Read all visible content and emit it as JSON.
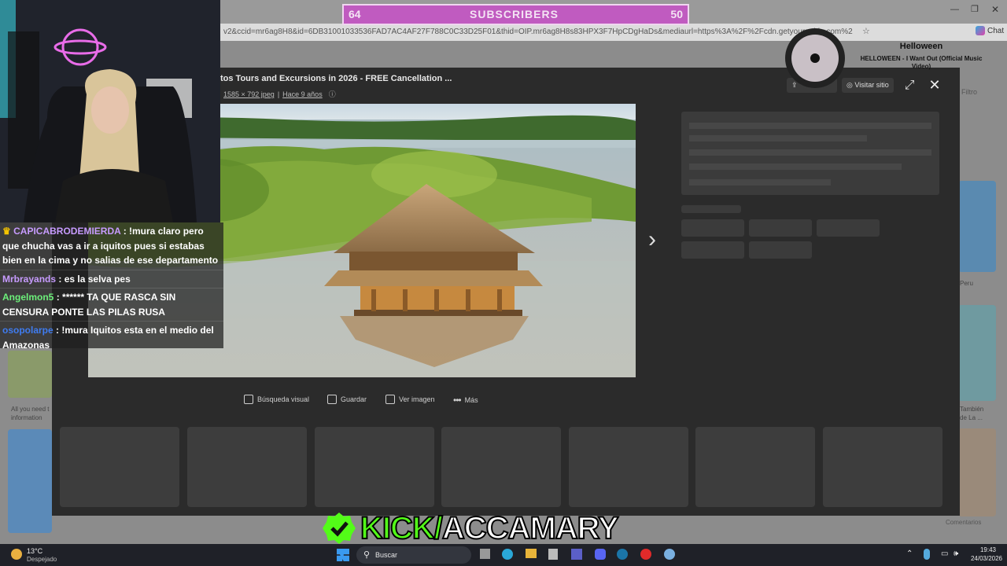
{
  "browser": {
    "url": "v2&ccid=mr6ag8H8&id=6DB31001033536FAD7AC4AF27F788C0C33D25F01&thid=OIP.mr6ag8H8s83HPX3F7HpCDgHaDs&mediaurl=https%3A%2F%2Fcdn.getyourguide.com%2",
    "chat_label": "Chat",
    "filter_label": "Filtro",
    "right_col_text_1": "Peru",
    "right_col_text_2": "También",
    "right_col_text_3": "de La ...",
    "left_col_text": "All you need t information",
    "comments_label": "Comentarios"
  },
  "viewer": {
    "title": "tos Tours and Excursions in 2026 - FREE Cancellation ...",
    "size": "1585 × 792 jpeg",
    "age": "Hace 9 años",
    "visit_site": "Visitar sitio",
    "actions": [
      "Búsqueda visual",
      "Guardar",
      "Ver imagen",
      "Más"
    ]
  },
  "subs": {
    "left": "64",
    "label": "SUBSCRIBERS",
    "right": "50"
  },
  "music": {
    "title": "Helloween",
    "subtitle": "HELLOWEEN - I Want Out (Official Music Video)"
  },
  "chat": [
    {
      "user": "CAPICABRODEMIERDA",
      "color": "#c79bff",
      "text": ": !mura claro pero que chucha vas a ir a iquitos pues si estabas bien en la cima y no salias de ese departamento",
      "badge": "crown-icon"
    },
    {
      "user": "Mrbrayands",
      "color": "#c79bff",
      "text": ": es la selva pes"
    },
    {
      "user": "Angelmon5",
      "color": "#6cf07a",
      "text": ": ****** TA QUE RASCA SIN CENSURA PONTE LAS PILAS RUSA"
    },
    {
      "user": "osopolarpe",
      "color": "#3f7cf0",
      "text": ": !mura Iquitos esta en el medio del Amazonas"
    }
  ],
  "kick": {
    "brand": "KICK/",
    "name": "ACCAMARY",
    "accent": "#53fc18"
  },
  "taskbar": {
    "temp": "13°C",
    "weather": "Despejado",
    "search": "Buscar",
    "time": "19:43",
    "date": "24/03/2026"
  }
}
